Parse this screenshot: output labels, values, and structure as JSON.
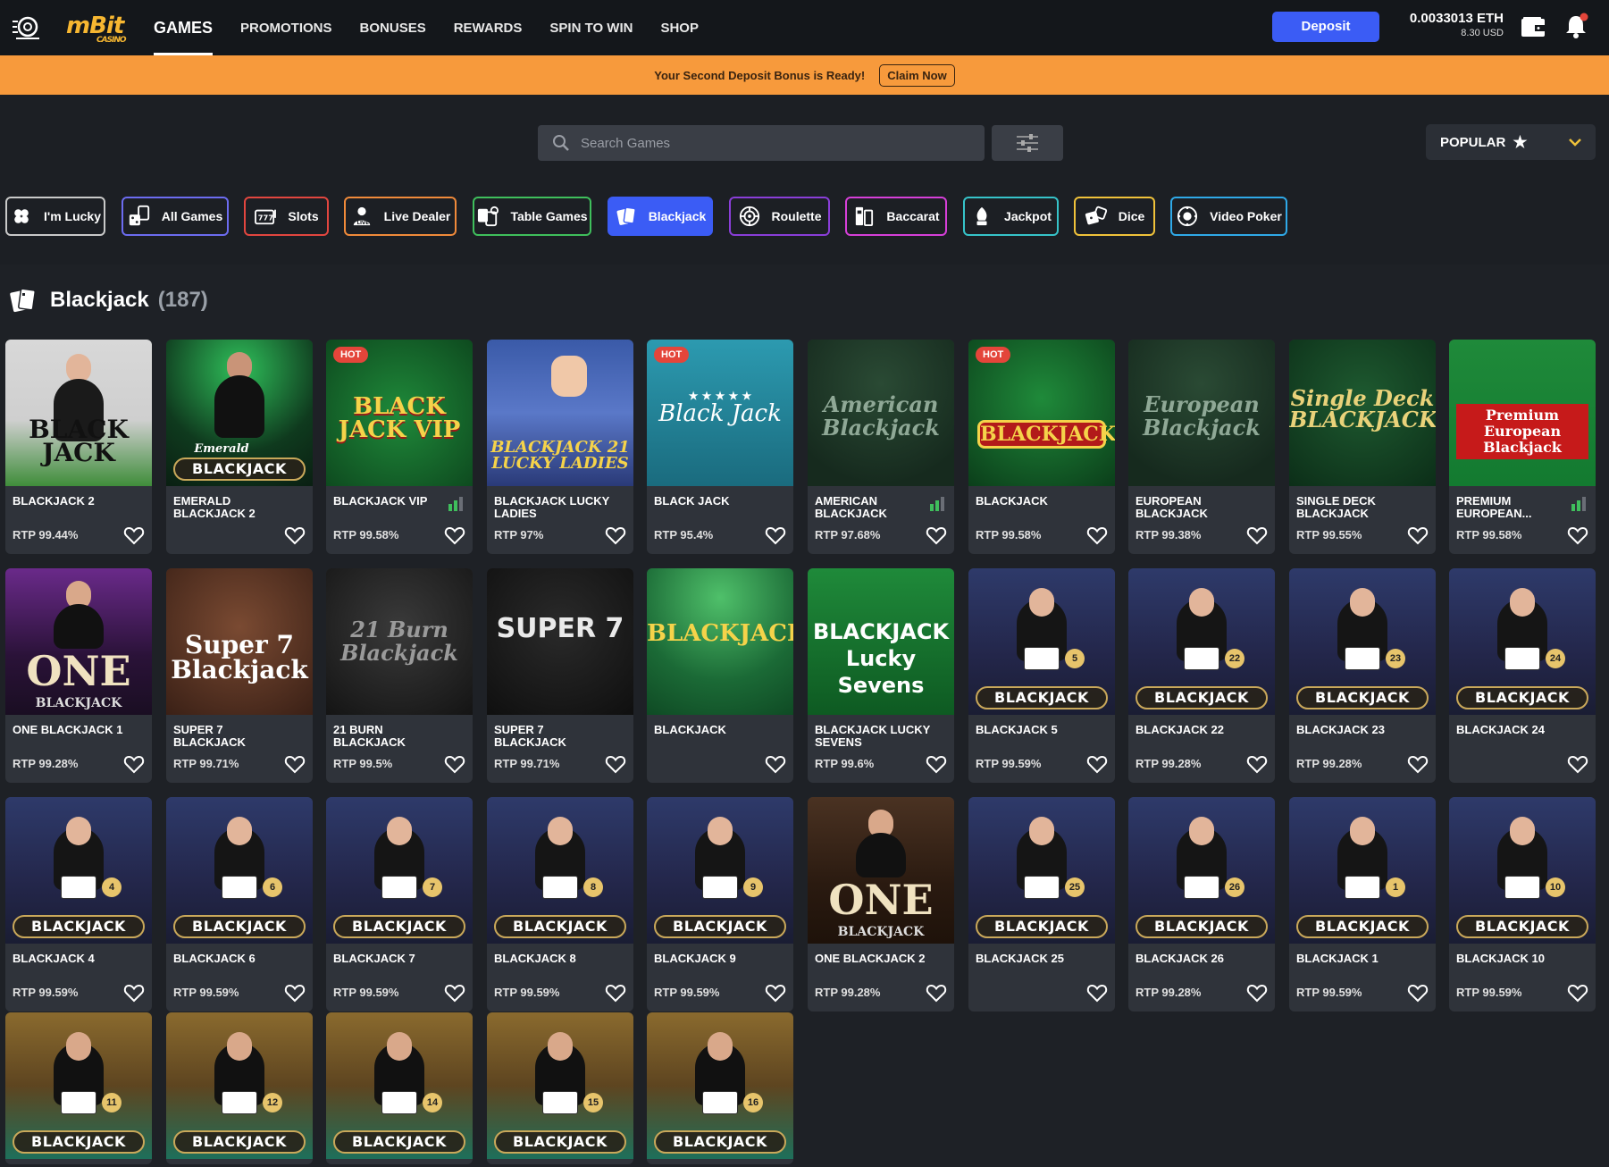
{
  "topnav": {
    "brand": "mBit",
    "brand_sub": "CASINO",
    "items": [
      "GAMES",
      "PROMOTIONS",
      "BONUSES",
      "REWARDS",
      "SPIN TO WIN",
      "SHOP"
    ],
    "deposit_label": "Deposit",
    "balance_eth": "0.0033013 ETH",
    "balance_usd": "8.30 USD"
  },
  "promo": {
    "text": "Your Second Deposit Bonus is Ready!",
    "claim_label": "Claim Now"
  },
  "search": {
    "placeholder": "Search Games",
    "sort_label": "POPULAR"
  },
  "categories": [
    {
      "label": "I'm Lucky",
      "color": "#c9c9c9",
      "icon": "clover-icon"
    },
    {
      "label": "All Games",
      "color": "#6c6cf0",
      "icon": "dice-cards-icon"
    },
    {
      "label": "Slots",
      "color": "#e2463f",
      "icon": "slot-machine-icon"
    },
    {
      "label": "Live Dealer",
      "color": "#f08a3a",
      "icon": "live-dealer-icon"
    },
    {
      "label": "Table Games",
      "color": "#3fbf5c",
      "icon": "table-games-icon"
    },
    {
      "label": "Blackjack",
      "color": "#3b5cf5",
      "icon": "blackjack-cards-icon",
      "active": true
    },
    {
      "label": "Roulette",
      "color": "#8a3ed8",
      "icon": "roulette-icon"
    },
    {
      "label": "Baccarat",
      "color": "#d63fd8",
      "icon": "baccarat-icon"
    },
    {
      "label": "Jackpot",
      "color": "#36c3c9",
      "icon": "jackpot-icon"
    },
    {
      "label": "Dice",
      "color": "#f0c23a",
      "icon": "dice-icon"
    },
    {
      "label": "Video Poker",
      "color": "#2fa9e8",
      "icon": "video-poker-icon"
    }
  ],
  "section": {
    "title": "Blackjack",
    "count": "(187)"
  },
  "games": [
    {
      "name": "BLACKJACK 2",
      "rtp": "RTP 99.44%",
      "style": "dealer-green"
    },
    {
      "name": "EMERALD BLACKJACK 2",
      "rtp": "",
      "style": "emerald"
    },
    {
      "name": "BLACKJACK VIP",
      "rtp": "RTP 99.58%",
      "style": "vip",
      "hot": "HOT",
      "bars": true
    },
    {
      "name": "BLACKJACK LUCKY LADIES",
      "rtp": "RTP 97%",
      "style": "lucky-ladies"
    },
    {
      "name": "BLACK JACK",
      "rtp": "RTP 95.4%",
      "style": "teal",
      "hot": "HOT"
    },
    {
      "name": "AMERICAN BLACKJACK",
      "rtp": "RTP 97.68%",
      "style": "felt-dark",
      "bars": true
    },
    {
      "name": "BLACKJACK",
      "rtp": "RTP 99.58%",
      "style": "red-classic",
      "hot": "HOT"
    },
    {
      "name": "EUROPEAN BLACKJACK",
      "rtp": "RTP 99.38%",
      "style": "felt-dark"
    },
    {
      "name": "SINGLE DECK BLACKJACK",
      "rtp": "RTP 99.55%",
      "style": "single-deck"
    },
    {
      "name": "PREMIUM EUROPEAN...",
      "rtp": "RTP 99.58%",
      "style": "premium",
      "bars": true
    },
    {
      "name": "ONE BLACKJACK 1",
      "rtp": "RTP 99.28%",
      "style": "one-purple"
    },
    {
      "name": "SUPER 7 BLACKJACK",
      "rtp": "RTP 99.71%",
      "style": "super7-brown"
    },
    {
      "name": "21 BURN BLACKJACK",
      "rtp": "RTP 99.5%",
      "style": "burn"
    },
    {
      "name": "SUPER 7 BLACKJACK",
      "rtp": "RTP 99.71%",
      "style": "super7-dark"
    },
    {
      "name": "BLACKJACK",
      "rtp": "",
      "style": "green-table"
    },
    {
      "name": "BLACKJACK LUCKY SEVENS",
      "rtp": "RTP 99.6%",
      "style": "lucky-sevens"
    },
    {
      "name": "BLACKJACK 5",
      "rtp": "RTP 99.59%",
      "style": "dealer-blue",
      "num": "5"
    },
    {
      "name": "BLACKJACK 22",
      "rtp": "RTP 99.28%",
      "style": "dealer-blue",
      "num": "22"
    },
    {
      "name": "BLACKJACK 23",
      "rtp": "RTP 99.28%",
      "style": "dealer-blue",
      "num": "23"
    },
    {
      "name": "BLACKJACK 24",
      "rtp": "",
      "style": "dealer-blue",
      "num": "24"
    },
    {
      "name": "BLACKJACK 4",
      "rtp": "RTP 99.59%",
      "style": "dealer-blue",
      "num": "4"
    },
    {
      "name": "BLACKJACK 6",
      "rtp": "RTP 99.59%",
      "style": "dealer-blue",
      "num": "6"
    },
    {
      "name": "BLACKJACK 7",
      "rtp": "RTP 99.59%",
      "style": "dealer-blue",
      "num": "7"
    },
    {
      "name": "BLACKJACK 8",
      "rtp": "RTP 99.59%",
      "style": "dealer-blue",
      "num": "8"
    },
    {
      "name": "BLACKJACK 9",
      "rtp": "RTP 99.59%",
      "style": "dealer-blue",
      "num": "9"
    },
    {
      "name": "ONE BLACKJACK 2",
      "rtp": "RTP 99.28%",
      "style": "one-brown"
    },
    {
      "name": "BLACKJACK 25",
      "rtp": "",
      "style": "dealer-blue",
      "num": "25"
    },
    {
      "name": "BLACKJACK 26",
      "rtp": "RTP 99.28%",
      "style": "dealer-blue",
      "num": "26"
    },
    {
      "name": "BLACKJACK 1",
      "rtp": "RTP 99.59%",
      "style": "dealer-blue",
      "num": "1"
    },
    {
      "name": "BLACKJACK 10",
      "rtp": "RTP 99.59%",
      "style": "dealer-blue",
      "num": "10"
    },
    {
      "name": "",
      "rtp": "",
      "style": "dealer-gold",
      "num": "11"
    },
    {
      "name": "",
      "rtp": "",
      "style": "dealer-gold",
      "num": "12"
    },
    {
      "name": "",
      "rtp": "",
      "style": "dealer-gold",
      "num": "14"
    },
    {
      "name": "",
      "rtp": "",
      "style": "dealer-gold",
      "num": "15"
    },
    {
      "name": "",
      "rtp": "",
      "style": "dealer-gold",
      "num": "16"
    }
  ],
  "thumb_texts": {
    "banner": "BLACKJACK",
    "bj": "BLACK JACK",
    "vip": "BLACK JACK VIP",
    "lucky": "BLACKJACK 21 LUCKY LADIES",
    "blackjack_script": "Black Jack",
    "american": "American Blackjack",
    "european": "European Blackjack",
    "single": "Single Deck BLACKJACK",
    "premium": "Premium European Blackjack",
    "one": "ONE",
    "super7": "Super 7 Blackjack",
    "burn": "21 Burn Blackjack",
    "super7b": "SUPER 7",
    "lucky7": "BLACKJACK Lucky Sevens",
    "emerald": "Emerald"
  }
}
